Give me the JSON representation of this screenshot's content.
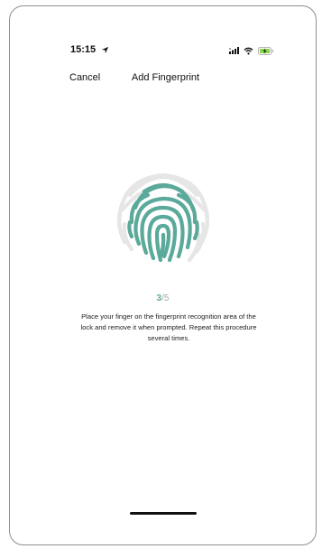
{
  "status_bar": {
    "time": "15:15",
    "icons": [
      "location-arrow-icon",
      "cellular-signal-icon",
      "wifi-icon",
      "battery-charging-icon"
    ]
  },
  "nav": {
    "cancel_label": "Cancel",
    "title": "Add Fingerprint"
  },
  "fingerprint": {
    "icon": "fingerprint-icon",
    "accent_color": "#5aa99a",
    "inactive_color": "#e6e6e6"
  },
  "progress": {
    "current": "3",
    "separator_total": "/5"
  },
  "instructions": "Place your finger on the fingerprint recognition area of the lock and remove it when prompted. Repeat this procedure several times.",
  "colors": {
    "accent": "#5aa99a",
    "battery_fill": "#8bd44a",
    "text": "#111111"
  }
}
